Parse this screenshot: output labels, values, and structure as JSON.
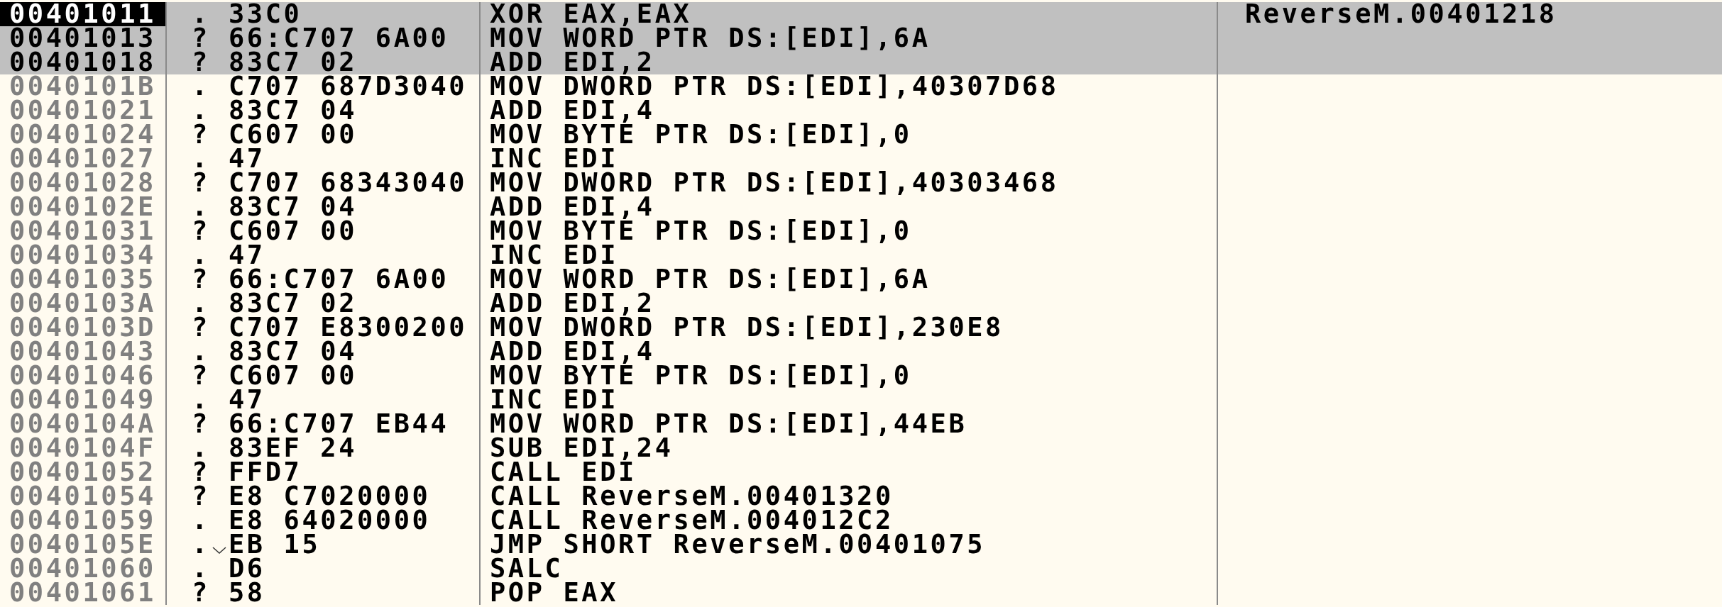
{
  "disassembly": {
    "rows": [
      {
        "address": "00401011",
        "marker": ".",
        "jump_mark": false,
        "hex": "33C0",
        "instruction": "XOR EAX,EAX",
        "comment": "ReverseM.00401218",
        "selected": true,
        "current": true
      },
      {
        "address": "00401013",
        "marker": "?",
        "jump_mark": false,
        "hex": "66:C707 6A00",
        "instruction": "MOV WORD PTR DS:[EDI],6A",
        "selected": true,
        "current": false
      },
      {
        "address": "00401018",
        "marker": "?",
        "jump_mark": false,
        "hex": "83C7 02",
        "instruction": "ADD EDI,2",
        "selected": true,
        "current": false
      },
      {
        "address": "0040101B",
        "marker": ".",
        "jump_mark": false,
        "hex": "C707 687D3040",
        "instruction": "MOV DWORD PTR DS:[EDI],40307D68",
        "selected": false,
        "current": false
      },
      {
        "address": "00401021",
        "marker": ".",
        "jump_mark": false,
        "hex": "83C7 04",
        "instruction": "ADD EDI,4",
        "selected": false,
        "current": false
      },
      {
        "address": "00401024",
        "marker": "?",
        "jump_mark": false,
        "hex": "C607 00",
        "instruction": "MOV BYTE PTR DS:[EDI],0",
        "selected": false,
        "current": false
      },
      {
        "address": "00401027",
        "marker": ".",
        "jump_mark": false,
        "hex": "47",
        "instruction": "INC EDI",
        "selected": false,
        "current": false
      },
      {
        "address": "00401028",
        "marker": "?",
        "jump_mark": false,
        "hex": "C707 68343040",
        "instruction": "MOV DWORD PTR DS:[EDI],40303468",
        "selected": false,
        "current": false
      },
      {
        "address": "0040102E",
        "marker": ".",
        "jump_mark": false,
        "hex": "83C7 04",
        "instruction": "ADD EDI,4",
        "selected": false,
        "current": false
      },
      {
        "address": "00401031",
        "marker": "?",
        "jump_mark": false,
        "hex": "C607 00",
        "instruction": "MOV BYTE PTR DS:[EDI],0",
        "selected": false,
        "current": false
      },
      {
        "address": "00401034",
        "marker": ".",
        "jump_mark": false,
        "hex": "47",
        "instruction": "INC EDI",
        "selected": false,
        "current": false
      },
      {
        "address": "00401035",
        "marker": "?",
        "jump_mark": false,
        "hex": "66:C707 6A00",
        "instruction": "MOV WORD PTR DS:[EDI],6A",
        "selected": false,
        "current": false
      },
      {
        "address": "0040103A",
        "marker": ".",
        "jump_mark": false,
        "hex": "83C7 02",
        "instruction": "ADD EDI,2",
        "selected": false,
        "current": false
      },
      {
        "address": "0040103D",
        "marker": "?",
        "jump_mark": false,
        "hex": "C707 E8300200",
        "instruction": "MOV DWORD PTR DS:[EDI],230E8",
        "selected": false,
        "current": false
      },
      {
        "address": "00401043",
        "marker": ".",
        "jump_mark": false,
        "hex": "83C7 04",
        "instruction": "ADD EDI,4",
        "selected": false,
        "current": false
      },
      {
        "address": "00401046",
        "marker": "?",
        "jump_mark": false,
        "hex": "C607 00",
        "instruction": "MOV BYTE PTR DS:[EDI],0",
        "selected": false,
        "current": false
      },
      {
        "address": "00401049",
        "marker": ".",
        "jump_mark": false,
        "hex": "47",
        "instruction": "INC EDI",
        "selected": false,
        "current": false
      },
      {
        "address": "0040104A",
        "marker": "?",
        "jump_mark": false,
        "hex": "66:C707 EB44",
        "instruction": "MOV WORD PTR DS:[EDI],44EB",
        "selected": false,
        "current": false
      },
      {
        "address": "0040104F",
        "marker": ".",
        "jump_mark": false,
        "hex": "83EF 24",
        "instruction": "SUB EDI,24",
        "selected": false,
        "current": false
      },
      {
        "address": "00401052",
        "marker": "?",
        "jump_mark": false,
        "hex": "FFD7",
        "instruction": "CALL EDI",
        "selected": false,
        "current": false
      },
      {
        "address": "00401054",
        "marker": "?",
        "jump_mark": false,
        "hex": "E8 C7020000",
        "instruction": "CALL ReverseM.00401320",
        "selected": false,
        "current": false
      },
      {
        "address": "00401059",
        "marker": ".",
        "jump_mark": false,
        "hex": "E8 64020000",
        "instruction": "CALL ReverseM.004012C2",
        "selected": false,
        "current": false
      },
      {
        "address": "0040105E",
        "marker": ".",
        "jump_mark": true,
        "hex": "EB 15",
        "instruction": "JMP SHORT ReverseM.00401075",
        "selected": false,
        "current": false
      },
      {
        "address": "00401060",
        "marker": ".",
        "jump_mark": false,
        "hex": "D6",
        "instruction": "SALC",
        "selected": false,
        "current": false
      },
      {
        "address": "00401061",
        "marker": "?",
        "jump_mark": false,
        "hex": "58",
        "instruction": "POP EAX",
        "selected": false,
        "current": false
      }
    ]
  }
}
